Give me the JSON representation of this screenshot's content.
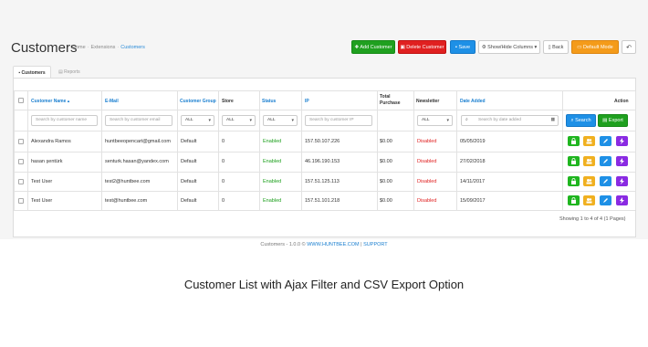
{
  "page": {
    "title": "Customers",
    "breadcrumb": [
      "Home",
      "Extensions",
      "Customers"
    ]
  },
  "toolbar": {
    "add_label": "Add Customer",
    "delete_label": "Delete Customer",
    "save_label": "Save",
    "showhide_label": "Show/Hide Columns",
    "back_label": "Back",
    "default_label": "Default Mode"
  },
  "tabs": [
    {
      "label": "Customers",
      "icon": "users-icon"
    },
    {
      "label": "Reports",
      "icon": "chart-icon"
    }
  ],
  "table": {
    "headers": {
      "name": "Customer Name",
      "email": "E-Mail",
      "group": "Customer Group",
      "store": "Store",
      "status": "Status",
      "ip": "IP",
      "total_line1": "Total",
      "total_line2": "Purchase",
      "newsletter": "Newsletter",
      "date_added": "Date Added",
      "action": "Action"
    },
    "filters": {
      "name_placeholder": "Search by customer name",
      "email_placeholder": "Search by customer email",
      "group_value": "ALL",
      "store_value": "ALL",
      "status_value": "ALL",
      "ip_placeholder": "Search by customer IP",
      "newsletter_value": "ALL",
      "date_placeholder": "Search by date added",
      "search_label": "Search",
      "export_label": "Export"
    },
    "rows": [
      {
        "name": "Alexandra Ramos",
        "email": "huntbeeopencart@gmail.com",
        "group": "Default",
        "store": "0",
        "status": "Enabled",
        "ip": "157.50.107.226",
        "total": "$0.00",
        "newsletter": "Disabled",
        "date": "05/05/2019"
      },
      {
        "name": "hasan şentürk",
        "email": "senturk.hasan@yandex.com",
        "group": "Default",
        "store": "0",
        "status": "Enabled",
        "ip": "46.196.190.153",
        "total": "$0.00",
        "newsletter": "Disabled",
        "date": "27/02/2018"
      },
      {
        "name": "Test User",
        "email": "test2@huntbee.com",
        "group": "Default",
        "store": "0",
        "status": "Enabled",
        "ip": "157.51.125.113",
        "total": "$0.00",
        "newsletter": "Disabled",
        "date": "14/11/2017"
      },
      {
        "name": "Test User",
        "email": "test@huntbee.com",
        "group": "Default",
        "store": "0",
        "status": "Enabled",
        "ip": "157.51.101.218",
        "total": "$0.00",
        "newsletter": "Disabled",
        "date": "15/09/2017"
      }
    ],
    "pagination_text": "Showing 1 to 4 of 4 (1 Pages)"
  },
  "footer": {
    "prefix": "Customers - 1.0.0 ©",
    "link1": "WWW.HUNTBEE.COM",
    "separator": "|",
    "link2": "SUPPORT"
  },
  "caption": "Customer List with Ajax Filter and CSV Export Option",
  "colors": {
    "accent_blue": "#1e90e6",
    "green": "#1fa01f",
    "red": "#e02020",
    "orange": "#f49b1a",
    "purple": "#8a2be2"
  }
}
